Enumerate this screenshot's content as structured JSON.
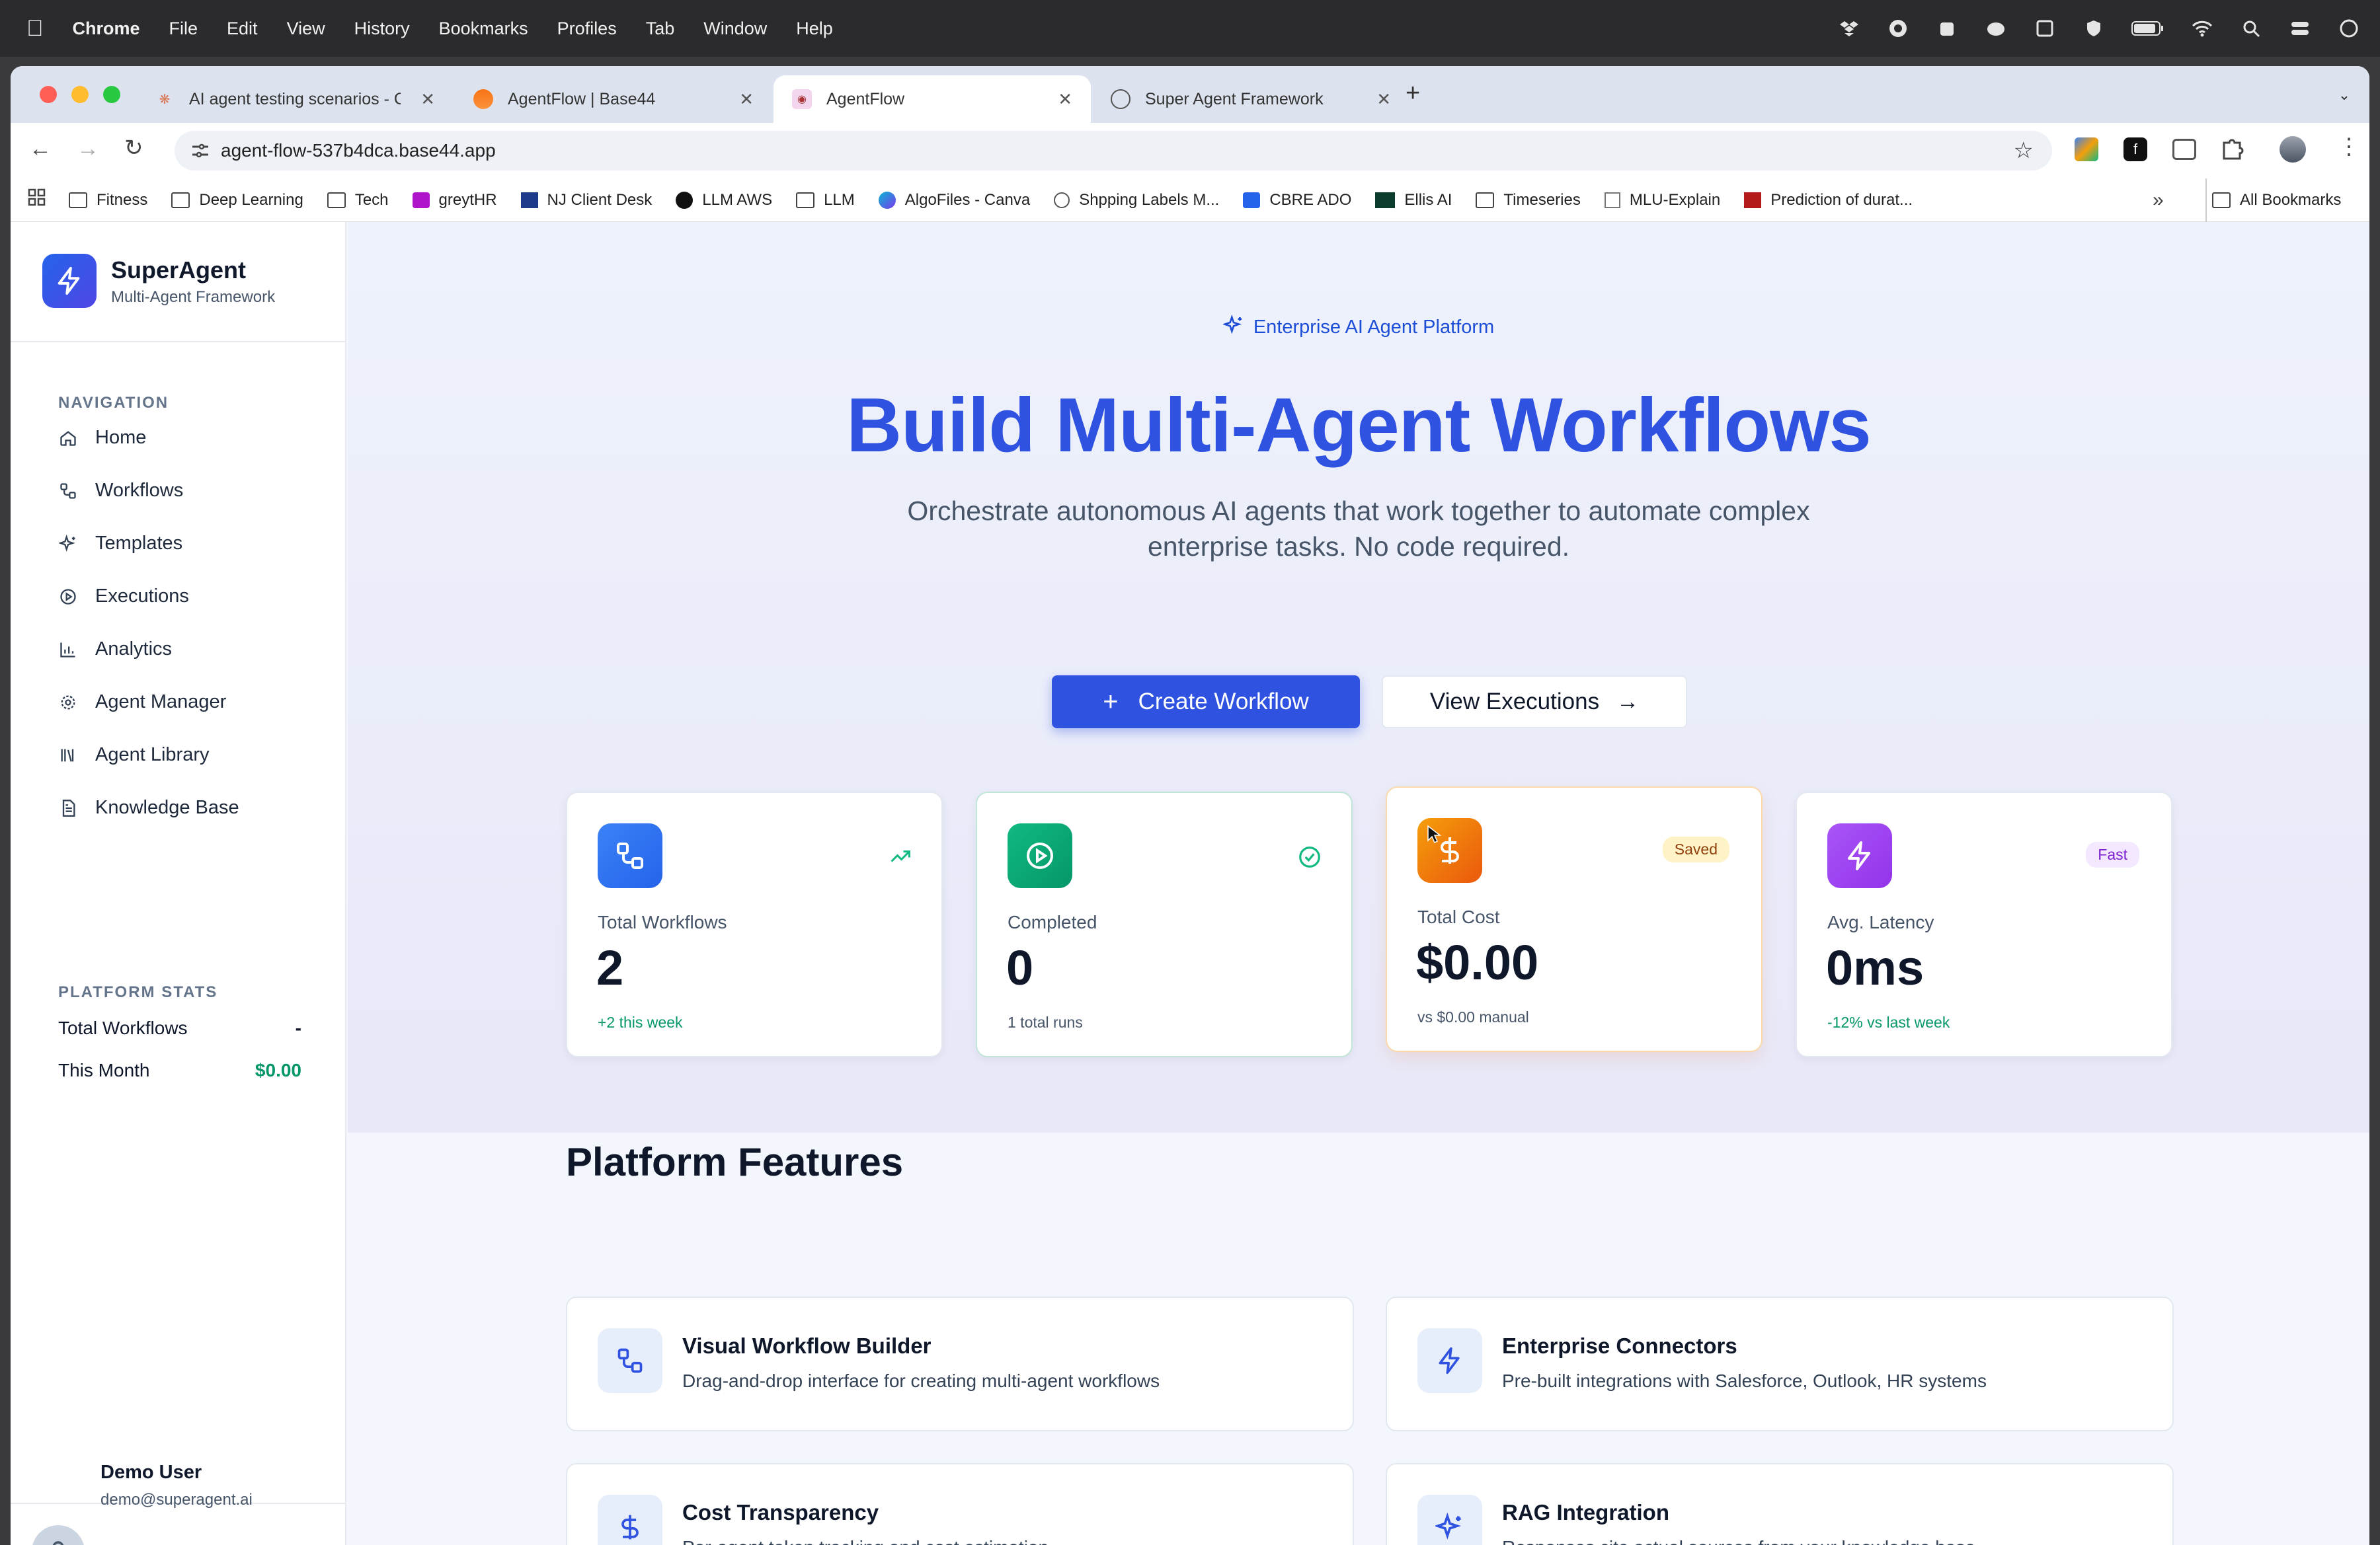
{
  "menubar": {
    "app": "Chrome",
    "items": [
      "File",
      "Edit",
      "View",
      "History",
      "Bookmarks",
      "Profiles",
      "Tab",
      "Window",
      "Help"
    ]
  },
  "tabs": [
    {
      "title": "AI agent testing scenarios - C",
      "active": false
    },
    {
      "title": "AgentFlow | Base44",
      "active": false
    },
    {
      "title": "AgentFlow",
      "active": true
    },
    {
      "title": "Super Agent Framework",
      "active": false
    }
  ],
  "address": {
    "url": "agent-flow-537b4dca.base44.app"
  },
  "bookmarks": [
    {
      "label": "Fitness",
      "icon": "folder-icon"
    },
    {
      "label": "Deep Learning",
      "icon": "folder-icon"
    },
    {
      "label": "Tech",
      "icon": "folder-icon"
    },
    {
      "label": "greytHR",
      "icon": "greythr-icon"
    },
    {
      "label": "NJ Client Desk",
      "icon": "nj-icon"
    },
    {
      "label": "LLM AWS",
      "icon": "github-icon"
    },
    {
      "label": "LLM",
      "icon": "folder-icon"
    },
    {
      "label": "AlgoFiles - Canva",
      "icon": "canva-icon"
    },
    {
      "label": "Shpping Labels M...",
      "icon": "globe-icon"
    },
    {
      "label": "CBRE ADO",
      "icon": "ado-icon"
    },
    {
      "label": "Ellis AI",
      "icon": "cbre-icon"
    },
    {
      "label": "Timeseries",
      "icon": "folder-icon"
    },
    {
      "label": "MLU-Explain",
      "icon": "mlu-icon"
    },
    {
      "label": "Prediction of durat...",
      "icon": "arxiv-icon"
    }
  ],
  "bookmarks_all": "All Bookmarks",
  "brand": {
    "name": "SuperAgent",
    "tagline": "Multi-Agent Framework"
  },
  "nav": {
    "heading": "NAVIGATION",
    "items": [
      {
        "label": "Home",
        "icon": "home-icon"
      },
      {
        "label": "Workflows",
        "icon": "workflow-icon"
      },
      {
        "label": "Templates",
        "icon": "sparkle-icon"
      },
      {
        "label": "Executions",
        "icon": "play-circle-icon"
      },
      {
        "label": "Analytics",
        "icon": "bar-chart-icon"
      },
      {
        "label": "Agent Manager",
        "icon": "gear-icon"
      },
      {
        "label": "Agent Library",
        "icon": "library-icon"
      },
      {
        "label": "Knowledge Base",
        "icon": "document-icon"
      }
    ]
  },
  "platform_stats": {
    "heading": "PLATFORM STATS",
    "rows": [
      {
        "label": "Total Workflows",
        "value": "-"
      },
      {
        "label": "This Month",
        "value": "$0.00"
      }
    ]
  },
  "user": {
    "name": "Demo User",
    "email": "demo@superagent.ai"
  },
  "hero": {
    "badge": "Enterprise AI Agent Platform",
    "title": "Build Multi-Agent Workflows",
    "subtitle_line1": "Orchestrate autonomous AI agents that work together to automate complex",
    "subtitle_line2": "enterprise tasks. No code required.",
    "primary_cta": "Create Workflow",
    "secondary_cta": "View Executions"
  },
  "stats": [
    {
      "label": "Total Workflows",
      "value": "2",
      "sub": "+2 this week",
      "icon": "workflow-icon",
      "corner": "trending-up-icon",
      "color": "#2563eb"
    },
    {
      "label": "Completed",
      "value": "0",
      "sub": "1 total runs",
      "icon": "play-circle-icon",
      "corner": "check-circle-icon",
      "color": "#059669"
    },
    {
      "label": "Total Cost",
      "value": "$0.00",
      "sub": "vs $0.00 manual",
      "icon": "dollar-icon",
      "badge": "Saved",
      "color": "#ea580c"
    },
    {
      "label": "Avg. Latency",
      "value": "0ms",
      "sub": "-12% vs last week",
      "icon": "bolt-icon",
      "badge": "Fast",
      "color": "#9333ea"
    }
  ],
  "features": {
    "heading": "Platform Features",
    "items": [
      {
        "title": "Visual Workflow Builder",
        "desc": "Drag-and-drop interface for creating multi-agent workflows",
        "icon": "workflow-icon"
      },
      {
        "title": "Enterprise Connectors",
        "desc": "Pre-built integrations with Salesforce, Outlook, HR systems",
        "icon": "bolt-icon"
      },
      {
        "title": "Cost Transparency",
        "desc": "Per-agent token tracking and cost estimation",
        "icon": "dollar-icon"
      },
      {
        "title": "RAG Integration",
        "desc": "Responses cite actual sources from your knowledge base",
        "icon": "sparkle-icon"
      }
    ]
  }
}
